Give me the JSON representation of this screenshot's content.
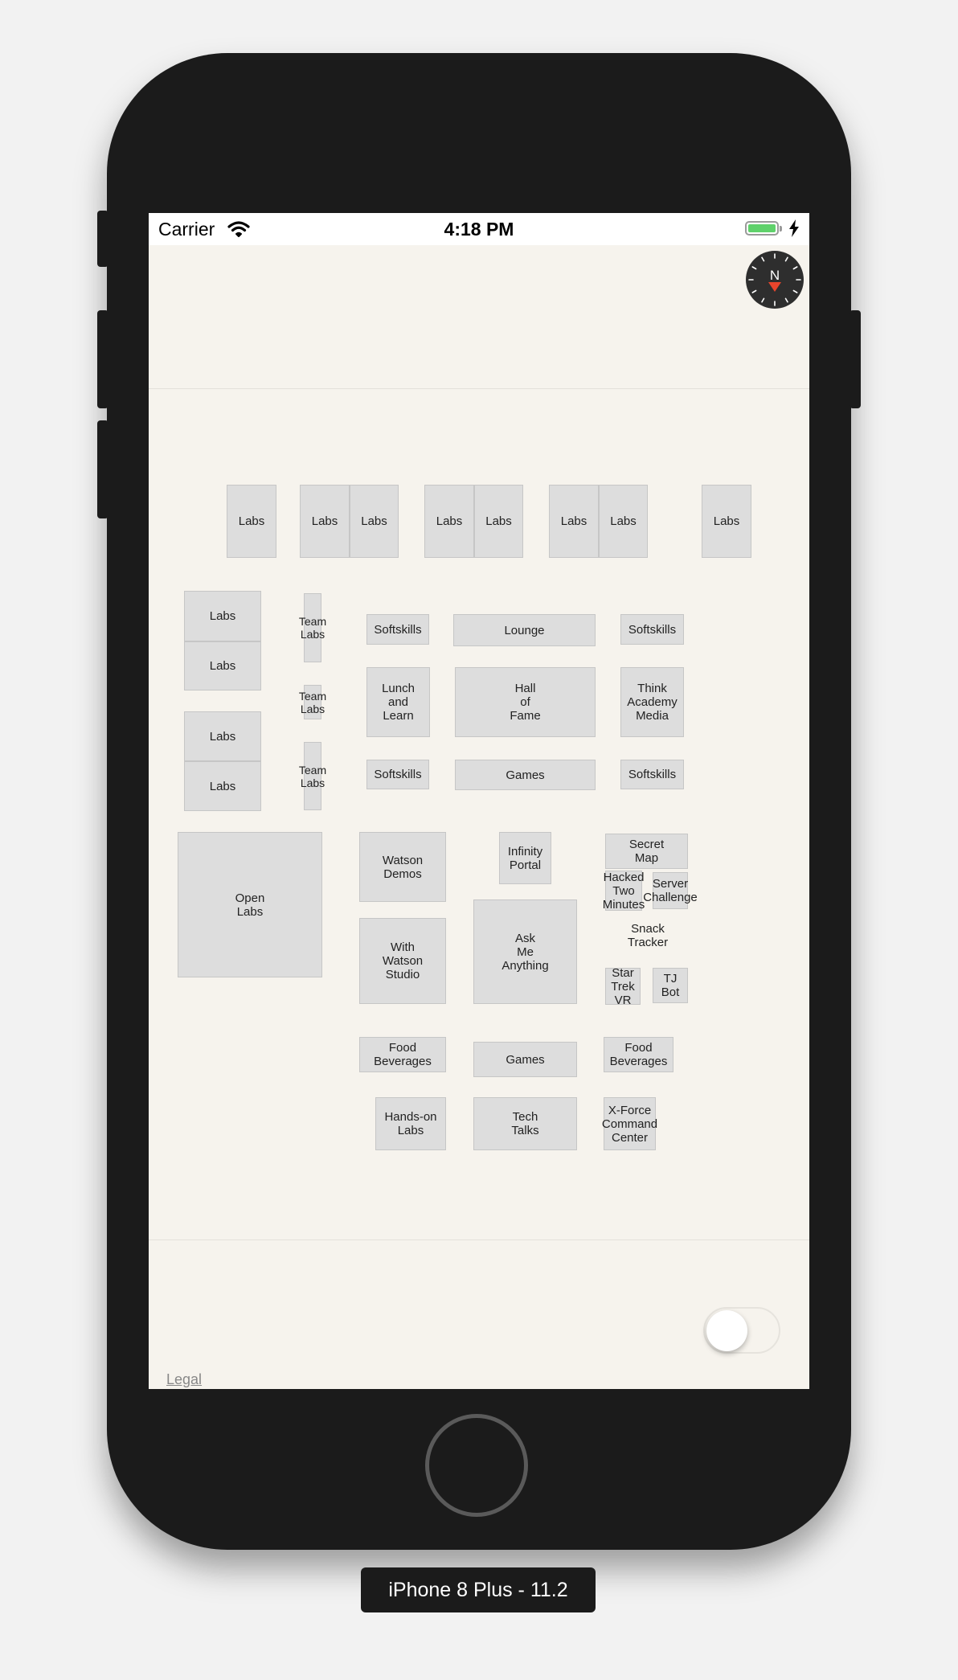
{
  "status_bar": {
    "carrier": "Carrier",
    "time": "4:18 PM"
  },
  "compass": {
    "letter": "N"
  },
  "floor_plan": {
    "rooms": [
      {
        "name": "labs-1",
        "label": "Labs"
      },
      {
        "name": "labs-2",
        "label": "Labs"
      },
      {
        "name": "labs-3",
        "label": "Labs"
      },
      {
        "name": "labs-4",
        "label": "Labs"
      },
      {
        "name": "labs-5",
        "label": "Labs"
      },
      {
        "name": "labs-6",
        "label": "Labs"
      },
      {
        "name": "labs-7",
        "label": "Labs"
      },
      {
        "name": "labs-8",
        "label": "Labs"
      },
      {
        "name": "labs-9",
        "label": "Labs"
      },
      {
        "name": "labs-10",
        "label": "Labs"
      },
      {
        "name": "labs-11",
        "label": "Labs"
      },
      {
        "name": "labs-12",
        "label": "Labs"
      },
      {
        "name": "team-labs-1",
        "label": "Team\nLabs"
      },
      {
        "name": "team-labs-2",
        "label": "Team\nLabs"
      },
      {
        "name": "team-labs-3",
        "label": "Team\nLabs"
      },
      {
        "name": "softskills-1",
        "label": "Softskills"
      },
      {
        "name": "lounge",
        "label": "Lounge"
      },
      {
        "name": "softskills-2",
        "label": "Softskills"
      },
      {
        "name": "lunch-and-learn",
        "label": "Lunch\nand\nLearn"
      },
      {
        "name": "hall-of-fame",
        "label": "Hall\nof\nFame"
      },
      {
        "name": "think-academy-media",
        "label": "Think\nAcademy\nMedia"
      },
      {
        "name": "softskills-3",
        "label": "Softskills"
      },
      {
        "name": "games-1",
        "label": "Games"
      },
      {
        "name": "softskills-4",
        "label": "Softskills"
      },
      {
        "name": "open-labs",
        "label": "Open\nLabs"
      },
      {
        "name": "watson-demos",
        "label": "Watson\nDemos"
      },
      {
        "name": "infinity-portal",
        "label": "Infinity\nPortal"
      },
      {
        "name": "secret-map",
        "label": "Secret\nMap"
      },
      {
        "name": "hacked-two-minutes",
        "label": "Hacked\nTwo\nMinutes"
      },
      {
        "name": "server-challenge",
        "label": "Server\nChallenge"
      },
      {
        "name": "with-watson-studio",
        "label": "With\nWatson\nStudio"
      },
      {
        "name": "ask-me-anything",
        "label": "Ask\nMe\nAnything"
      },
      {
        "name": "snack-tracker",
        "label": "Snack\nTracker"
      },
      {
        "name": "star-trek-vr",
        "label": "Star\nTrek\nVR"
      },
      {
        "name": "tj-bot",
        "label": "TJ\nBot"
      },
      {
        "name": "food-beverages-1",
        "label": "Food\nBeverages"
      },
      {
        "name": "games-2",
        "label": "Games"
      },
      {
        "name": "food-beverages-2",
        "label": "Food\nBeverages"
      },
      {
        "name": "hands-on-labs",
        "label": "Hands-on\nLabs"
      },
      {
        "name": "tech-talks",
        "label": "Tech\nTalks"
      },
      {
        "name": "x-force-command-center",
        "label": "X-Force\nCommand\nCenter"
      }
    ]
  },
  "footer": {
    "legal_link": "Legal",
    "toggle_on": false
  },
  "device": {
    "label": "iPhone 8 Plus - 11.2"
  },
  "colors": {
    "room_fill": "#dddddd",
    "room_border": "#c6c6c6",
    "background": "#f6f3ed",
    "battery": "#5fd16b",
    "compass_needle": "#e8452c"
  }
}
